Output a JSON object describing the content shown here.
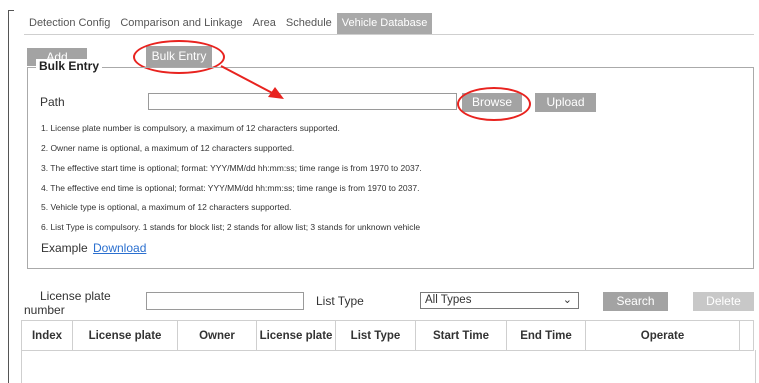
{
  "tabs": [
    {
      "label": "Detection Config",
      "active": false
    },
    {
      "label": "Comparison and Linkage",
      "active": false
    },
    {
      "label": "Area",
      "active": false
    },
    {
      "label": "Schedule",
      "active": false
    },
    {
      "label": "Vehicle Database",
      "active": true
    }
  ],
  "toolbar": {
    "add_label": "Add",
    "bulk_entry_label": "Bulk Entry"
  },
  "bulk": {
    "legend": "Bulk Entry",
    "path_label": "Path",
    "path_value": "",
    "browse_label": "Browse",
    "upload_label": "Upload",
    "notes": [
      "1. License plate number is compulsory, a maximum of 12 characters supported.",
      "2. Owner name is optional, a maximum of 12 characters supported.",
      "3. The effective start time is optional; format: YYY/MM/dd hh:mm:ss; time range is from 1970 to 2037.",
      "4. The effective end time is optional; format: YYY/MM/dd hh:mm:ss; time range is from 1970 to 2037.",
      "5. Vehicle type is optional, a maximum of 12 characters supported.",
      "6. List Type is compulsory. 1 stands for block list; 2 stands for allow list; 3 stands for unknown vehicle"
    ],
    "example_label": "Example",
    "download_label": "Download"
  },
  "search": {
    "plate_label_line1": "License plate",
    "plate_label_line2": "number",
    "plate_value": "",
    "list_type_label": "List Type",
    "list_type_selected": "All Types",
    "search_label": "Search",
    "delete_label": "Delete"
  },
  "table": {
    "headers": [
      "Index",
      "License plate",
      "Owner",
      "License plate",
      "List Type",
      "Start Time",
      "End Time",
      "Operate",
      ""
    ]
  },
  "colors": {
    "annotation": "#e8231f",
    "button": "#a3a3a3",
    "link": "#2a6fcf"
  }
}
